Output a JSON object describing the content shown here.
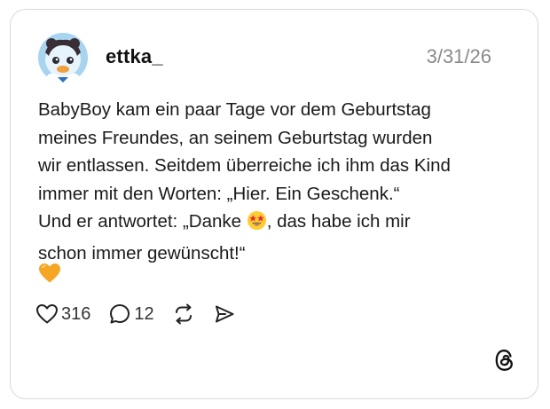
{
  "post": {
    "username": "ettka_",
    "date": "3/31/26",
    "lines": [
      "BabyBoy kam ein paar Tage vor dem Geburtstag",
      "meines Freundes, an seinem Geburtstag wurden",
      "wir entlassen. Seitdem überreiche ich ihm das Kind",
      "immer mit den Worten: „Hier. Ein Geschenk.“"
    ],
    "line5_before": "Und er antwortet: „Danke ",
    "line5_after": ", das habe ich mir",
    "line6": "schon immer gewünscht!“",
    "inline_emoji": "star-struck-emoji",
    "closing_emoji": "orange-heart-emoji"
  },
  "actions": {
    "likes": "316",
    "replies": "12",
    "icons": [
      "heart-icon",
      "reply-icon",
      "repost-icon",
      "share-icon"
    ]
  },
  "branding": {
    "logo": "threads-logo-icon"
  },
  "colors": {
    "text": "#1a1a1a",
    "muted": "#8a8a8a",
    "border": "#d9d9d9",
    "heart_emoji": "#f5a623",
    "emoji_face": "#ffcc33"
  }
}
